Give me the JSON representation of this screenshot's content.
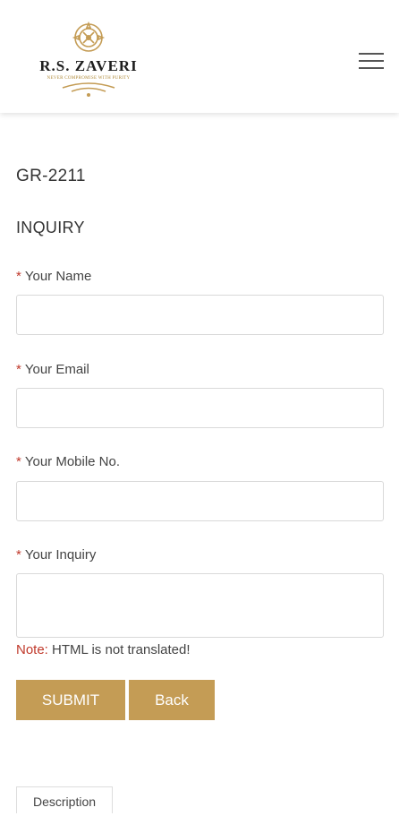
{
  "header": {
    "logo_name": "R.S. ZAVERI",
    "logo_tagline": "NEVER COMPROMISE WITH PURITY",
    "menu_icon": "hamburger-menu-icon"
  },
  "product": {
    "code": "GR-2211"
  },
  "form": {
    "title": "INQUIRY",
    "required_marker": "*",
    "fields": [
      {
        "label": "Your Name",
        "value": ""
      },
      {
        "label": "Your Email",
        "value": ""
      },
      {
        "label": "Your Mobile No.",
        "value": ""
      },
      {
        "label": "Your Inquiry",
        "value": ""
      }
    ],
    "note_label": "Note:",
    "note_text": " HTML is not translated!",
    "submit_label": "SUBMIT",
    "back_label": "Back"
  },
  "tabs": {
    "description_label": "Description"
  },
  "colors": {
    "accent_gold": "#c49c55",
    "required_red": "#c0392b"
  }
}
